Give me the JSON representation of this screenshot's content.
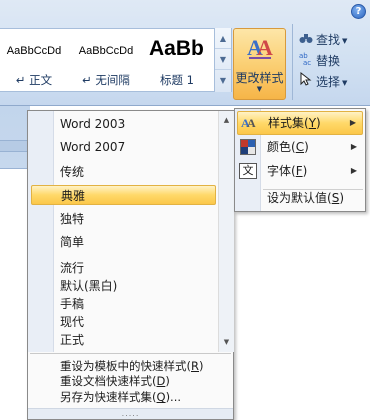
{
  "ribbon": {
    "help_label": "?",
    "styles": [
      {
        "sample": "AaBbCcDd",
        "name": "↵ 正文"
      },
      {
        "sample": "AaBbCcDd",
        "name": "↵ 无间隔"
      },
      {
        "sample": "AaBb",
        "name": "标题 1"
      }
    ],
    "change_styles_label": "更改样式",
    "editing": {
      "find_label": "查找",
      "replace_label": "替换",
      "select_label": "选择"
    }
  },
  "style_set_menu": {
    "items": [
      {
        "label": "Word 2003"
      },
      {
        "label": "Word 2007"
      },
      {
        "label": "传统"
      },
      {
        "label": "典雅",
        "selected": true
      },
      {
        "label": "独特"
      },
      {
        "label": "简单"
      },
      {
        "label": "流行"
      },
      {
        "label": "默认(黑白)"
      },
      {
        "label": "手稿"
      },
      {
        "label": "现代"
      },
      {
        "label": "正式"
      }
    ],
    "commands": {
      "reset_template": "重设为模板中的快速样式(",
      "reset_template_key": "R",
      "reset_document": "重设文档快速样式(",
      "reset_document_key": "D",
      "save_as": "另存为快速样式集(",
      "save_as_key": "Q",
      "save_as_suffix": ")..."
    },
    "grip": "....."
  },
  "change_styles_menu": {
    "items": [
      {
        "label": "样式集(",
        "key": "Y"
      },
      {
        "label": "颜色(",
        "key": "C"
      },
      {
        "label": "字体(",
        "key": "F"
      },
      {
        "label": "设为默认值(",
        "key": "S"
      }
    ],
    "close_paren": ")"
  },
  "colors": {
    "ribbon_bg": "#d2e1f2",
    "highlight": "#ffd969",
    "menu_bg": "#fafafa"
  }
}
